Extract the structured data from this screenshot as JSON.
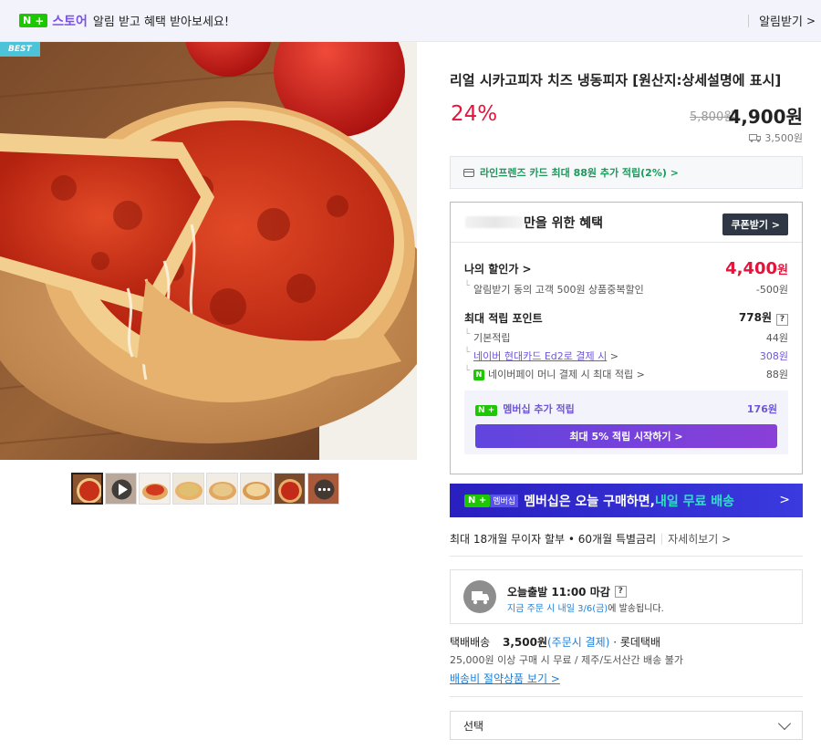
{
  "topbar": {
    "brand_n": "N",
    "brand_plus": "+",
    "store": "스토어",
    "message": "알림 받고 혜택 받아보세요!",
    "notify_label": "알림받기",
    "notify_chevron": ">"
  },
  "gallery": {
    "best_badge": "BEST",
    "thumb_icons": [
      "pizza-photo",
      "play-icon",
      "pizza-photo",
      "pizza-photo",
      "pizza-photo",
      "pizza-photo",
      "pizza-photo",
      "more-icon"
    ]
  },
  "product": {
    "title": "리얼 시카고피자 치즈 냉동피자 [원산지:상세설명에 표시]",
    "discount": "24%",
    "original_price": "5,800원",
    "price": "4,900원",
    "shipping_fee": "3,500원"
  },
  "card_banner": {
    "text": "라인프렌즈 카드 최대 88원 추가 적립(2%) >"
  },
  "benefit": {
    "title_suffix": "만을 위한 혜택",
    "coupon_button": "쿠폰받기 >",
    "my_price_label": "나의 할인가 >",
    "my_price_value": "4,400",
    "my_price_unit": "원",
    "my_price_sub_label": "알림받기 동의 고객 500원 상품중복할인",
    "my_price_sub_value": "-500원",
    "points_label": "최대 적립 포인트",
    "points_value": "778원",
    "points_help": "?",
    "basic_label": "기본적립",
    "basic_value": "44원",
    "card_label": "네이버 현대카드 Ed2로 결제 시",
    "card_chevron": ">",
    "card_value": "308원",
    "npay_icon": "N",
    "npay_label": "네이버페이 머니 결제 시 최대 적립",
    "npay_chevron": ">",
    "npay_value": "88원",
    "member_tag_n": "N",
    "member_tag_plus": "+",
    "member_label": "멤버십 추가 적립",
    "member_value": "176원",
    "start_button": "최대 5% 적립 시작하기 >"
  },
  "membership_banner": {
    "tag_n": "N",
    "tag_plus": "+",
    "tag_text": "멤버십",
    "text": "멤버십은 오늘 구매하면, ",
    "highlight": "내일 무료 배송",
    "chevron": ">"
  },
  "installment": {
    "text": "최대 18개월 무이자 할부 • 60개월 특별금리",
    "more": "자세히보기 >"
  },
  "delivery": {
    "title": "오늘출발 11:00 마감",
    "help": "?",
    "sub_highlight": "지금 주문 시 내일 3/6(금)",
    "sub_rest": "에 발송됩니다."
  },
  "shipping": {
    "method": "택배배송",
    "fee": "3,500원",
    "fee_note": "(주문시 결제)",
    "carrier": "· 롯데택배",
    "condition": "25,000원 이상 구매 시 무료 / 제주/도서산간 배송 불가",
    "saving_link": "배송비 절약상품 보기 >"
  },
  "option_select": {
    "label": "선택"
  },
  "colors": {
    "accent_red": "#e8133a",
    "naver_green": "#1ec800",
    "store_purple": "#7c52e6",
    "membership_blue": "#2a1fbf",
    "link_blue": "#1e7fd8"
  }
}
